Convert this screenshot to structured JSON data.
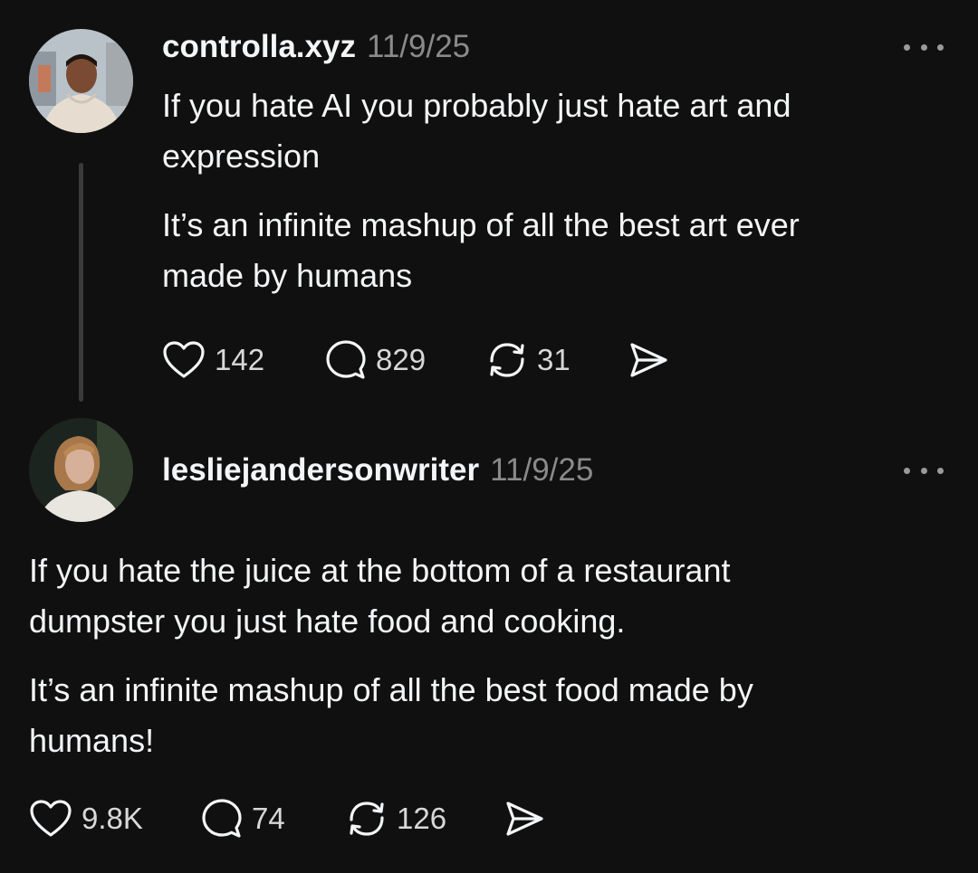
{
  "posts": [
    {
      "username": "controlla.xyz",
      "timestamp": "11/9/25",
      "paragraphs": [
        "If you hate AI you probably just hate art and",
        "expression",
        "It’s an infinite mashup of all the best art ever",
        "made by humans"
      ],
      "likes": "142",
      "replies": "829",
      "reposts": "31"
    },
    {
      "username": "lesliejandersonwriter",
      "timestamp": "11/9/25",
      "paragraphs": [
        "If you hate the juice at the bottom of a restaurant",
        "dumpster you just hate food and cooking.",
        "It’s an infinite mashup of all the best food made by",
        "humans!"
      ],
      "likes": "9.8K",
      "replies": "74",
      "reposts": "126"
    }
  ],
  "icons": {
    "like": "heart-icon",
    "reply": "comment-bubble-icon",
    "repost": "repost-arrows-icon",
    "share": "send-icon",
    "more": "more-horizontal-icon"
  },
  "colors": {
    "background": "#101010",
    "primary_text": "#f3f5f7",
    "secondary_text": "#8a8a8a",
    "thread_line": "#3a3a3a"
  }
}
